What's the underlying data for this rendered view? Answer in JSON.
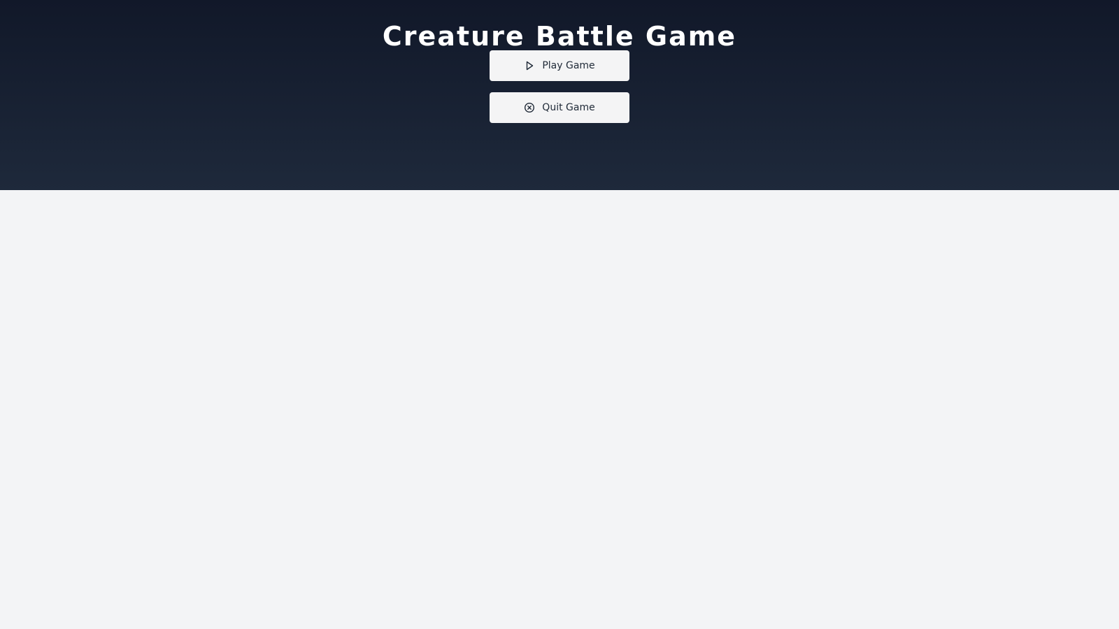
{
  "title": "Creature Battle Game",
  "menu": {
    "play_label": "Play Game",
    "play_icon": "play-icon",
    "quit_label": "Quit Game",
    "quit_icon": "close-circle-icon"
  },
  "colors": {
    "hero_top": "#111829",
    "hero_bottom": "#1e293b",
    "page_background": "#f3f4f6",
    "button_background": "#f4f4f5",
    "title_text": "#ffffff"
  }
}
